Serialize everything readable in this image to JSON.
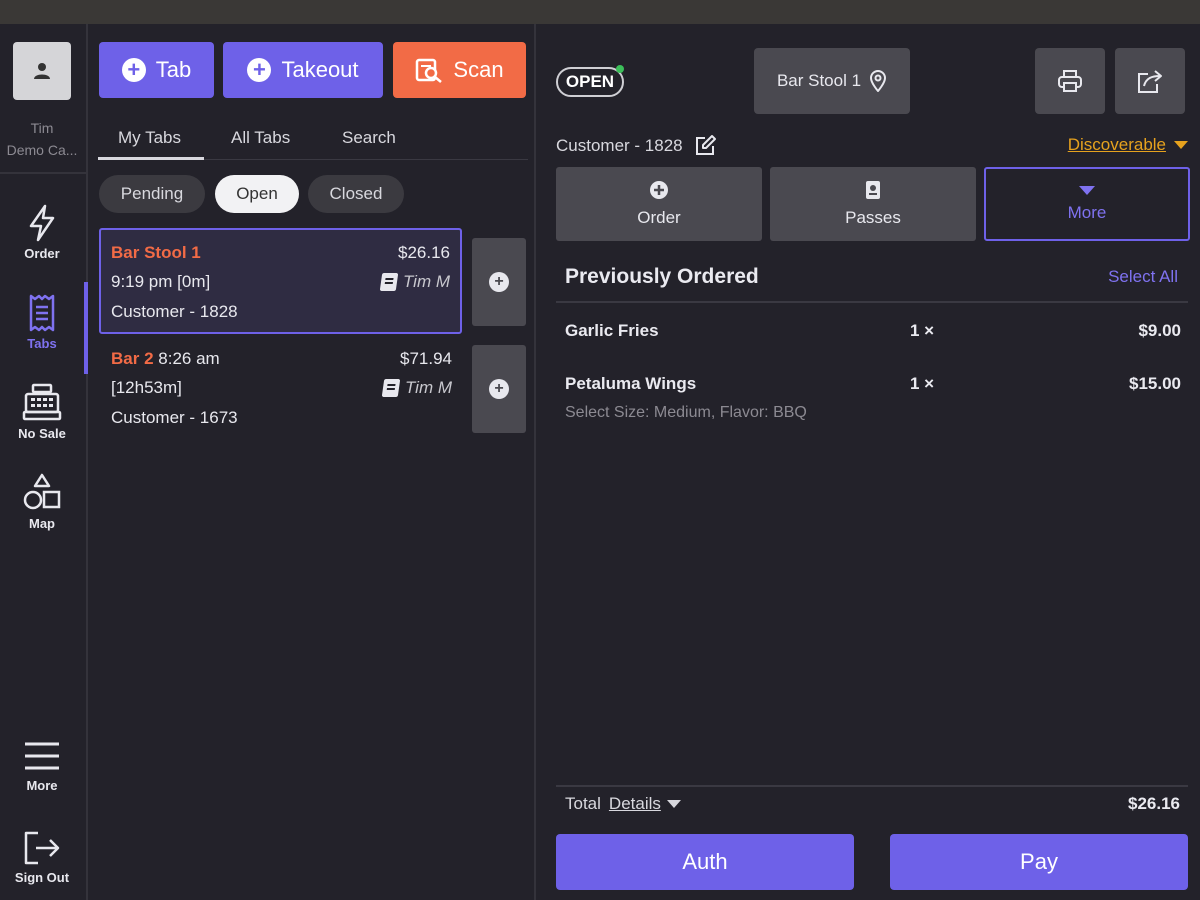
{
  "user": {
    "name": "Tim",
    "location": "Demo Ca..."
  },
  "rail": {
    "items": [
      {
        "label": "Order",
        "icon": "lightning-icon"
      },
      {
        "label": "Tabs",
        "icon": "receipt-icon"
      },
      {
        "label": "No Sale",
        "icon": "cash-register-icon"
      },
      {
        "label": "Map",
        "icon": "shapes-icon"
      },
      {
        "label": "More",
        "icon": "menu-icon"
      },
      {
        "label": "Sign Out",
        "icon": "sign-out-icon"
      }
    ],
    "active": "Tabs"
  },
  "actions": {
    "tab": "Tab",
    "takeout": "Takeout",
    "scan": "Scan"
  },
  "subtabs": [
    "My Tabs",
    "All Tabs",
    "Search"
  ],
  "filters": {
    "pending": "Pending",
    "open": "Open",
    "closed": "Closed",
    "active": "Open"
  },
  "tabs": [
    {
      "location": "Bar Stool 1",
      "time": "9:19 pm [0m]",
      "price": "$26.16",
      "server": "Tim M",
      "customer": "Customer - 1828"
    },
    {
      "location": "Bar 2",
      "time_a": "8:26 am",
      "time_b": "[12h53m]",
      "price": "$71.94",
      "server": "Tim M",
      "customer": "Customer - 1673"
    }
  ],
  "detail": {
    "status": "OPEN",
    "location": "Bar Stool 1",
    "customer": "Customer - 1828",
    "discoverable": "Discoverable",
    "buttons": {
      "order": "Order",
      "passes": "Passes",
      "more": "More"
    },
    "previously_ordered": "Previously Ordered",
    "select_all": "Select All",
    "items": [
      {
        "name": "Garlic Fries",
        "qty": "1 ×",
        "amount": "$9.00",
        "mods": ""
      },
      {
        "name": "Petaluma Wings",
        "qty": "1 ×",
        "amount": "$15.00",
        "mods": "Select Size: Medium, Flavor: BBQ"
      }
    ],
    "total_label": "Total",
    "details_link": "Details",
    "total": "$26.16",
    "auth": "Auth",
    "pay": "Pay"
  },
  "colors": {
    "accent": "#6e61e8",
    "orange": "#f26b46",
    "warning": "#e6a21e",
    "status_green": "#3cbf5a"
  }
}
